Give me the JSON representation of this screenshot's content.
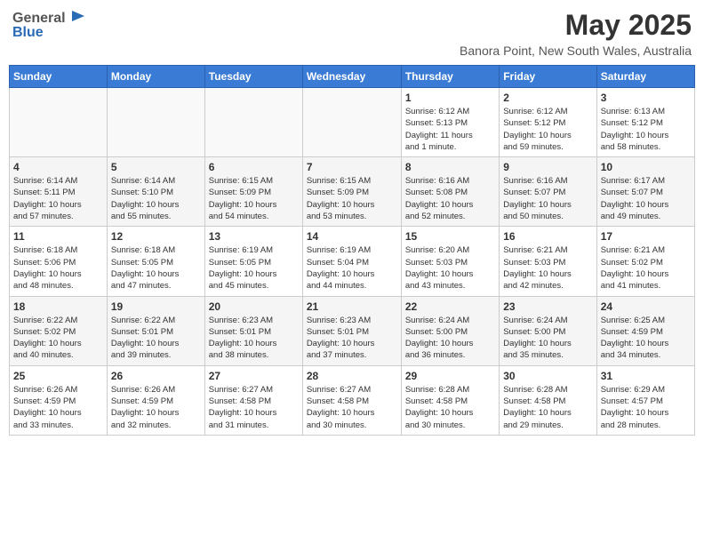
{
  "logo": {
    "general": "General",
    "blue": "Blue"
  },
  "title": {
    "month_year": "May 2025",
    "location": "Banora Point, New South Wales, Australia"
  },
  "weekdays": [
    "Sunday",
    "Monday",
    "Tuesday",
    "Wednesday",
    "Thursday",
    "Friday",
    "Saturday"
  ],
  "weeks": [
    [
      {
        "day": "",
        "info": ""
      },
      {
        "day": "",
        "info": ""
      },
      {
        "day": "",
        "info": ""
      },
      {
        "day": "",
        "info": ""
      },
      {
        "day": "1",
        "info": "Sunrise: 6:12 AM\nSunset: 5:13 PM\nDaylight: 11 hours\nand 1 minute."
      },
      {
        "day": "2",
        "info": "Sunrise: 6:12 AM\nSunset: 5:12 PM\nDaylight: 10 hours\nand 59 minutes."
      },
      {
        "day": "3",
        "info": "Sunrise: 6:13 AM\nSunset: 5:12 PM\nDaylight: 10 hours\nand 58 minutes."
      }
    ],
    [
      {
        "day": "4",
        "info": "Sunrise: 6:14 AM\nSunset: 5:11 PM\nDaylight: 10 hours\nand 57 minutes."
      },
      {
        "day": "5",
        "info": "Sunrise: 6:14 AM\nSunset: 5:10 PM\nDaylight: 10 hours\nand 55 minutes."
      },
      {
        "day": "6",
        "info": "Sunrise: 6:15 AM\nSunset: 5:09 PM\nDaylight: 10 hours\nand 54 minutes."
      },
      {
        "day": "7",
        "info": "Sunrise: 6:15 AM\nSunset: 5:09 PM\nDaylight: 10 hours\nand 53 minutes."
      },
      {
        "day": "8",
        "info": "Sunrise: 6:16 AM\nSunset: 5:08 PM\nDaylight: 10 hours\nand 52 minutes."
      },
      {
        "day": "9",
        "info": "Sunrise: 6:16 AM\nSunset: 5:07 PM\nDaylight: 10 hours\nand 50 minutes."
      },
      {
        "day": "10",
        "info": "Sunrise: 6:17 AM\nSunset: 5:07 PM\nDaylight: 10 hours\nand 49 minutes."
      }
    ],
    [
      {
        "day": "11",
        "info": "Sunrise: 6:18 AM\nSunset: 5:06 PM\nDaylight: 10 hours\nand 48 minutes."
      },
      {
        "day": "12",
        "info": "Sunrise: 6:18 AM\nSunset: 5:05 PM\nDaylight: 10 hours\nand 47 minutes."
      },
      {
        "day": "13",
        "info": "Sunrise: 6:19 AM\nSunset: 5:05 PM\nDaylight: 10 hours\nand 45 minutes."
      },
      {
        "day": "14",
        "info": "Sunrise: 6:19 AM\nSunset: 5:04 PM\nDaylight: 10 hours\nand 44 minutes."
      },
      {
        "day": "15",
        "info": "Sunrise: 6:20 AM\nSunset: 5:03 PM\nDaylight: 10 hours\nand 43 minutes."
      },
      {
        "day": "16",
        "info": "Sunrise: 6:21 AM\nSunset: 5:03 PM\nDaylight: 10 hours\nand 42 minutes."
      },
      {
        "day": "17",
        "info": "Sunrise: 6:21 AM\nSunset: 5:02 PM\nDaylight: 10 hours\nand 41 minutes."
      }
    ],
    [
      {
        "day": "18",
        "info": "Sunrise: 6:22 AM\nSunset: 5:02 PM\nDaylight: 10 hours\nand 40 minutes."
      },
      {
        "day": "19",
        "info": "Sunrise: 6:22 AM\nSunset: 5:01 PM\nDaylight: 10 hours\nand 39 minutes."
      },
      {
        "day": "20",
        "info": "Sunrise: 6:23 AM\nSunset: 5:01 PM\nDaylight: 10 hours\nand 38 minutes."
      },
      {
        "day": "21",
        "info": "Sunrise: 6:23 AM\nSunset: 5:01 PM\nDaylight: 10 hours\nand 37 minutes."
      },
      {
        "day": "22",
        "info": "Sunrise: 6:24 AM\nSunset: 5:00 PM\nDaylight: 10 hours\nand 36 minutes."
      },
      {
        "day": "23",
        "info": "Sunrise: 6:24 AM\nSunset: 5:00 PM\nDaylight: 10 hours\nand 35 minutes."
      },
      {
        "day": "24",
        "info": "Sunrise: 6:25 AM\nSunset: 4:59 PM\nDaylight: 10 hours\nand 34 minutes."
      }
    ],
    [
      {
        "day": "25",
        "info": "Sunrise: 6:26 AM\nSunset: 4:59 PM\nDaylight: 10 hours\nand 33 minutes."
      },
      {
        "day": "26",
        "info": "Sunrise: 6:26 AM\nSunset: 4:59 PM\nDaylight: 10 hours\nand 32 minutes."
      },
      {
        "day": "27",
        "info": "Sunrise: 6:27 AM\nSunset: 4:58 PM\nDaylight: 10 hours\nand 31 minutes."
      },
      {
        "day": "28",
        "info": "Sunrise: 6:27 AM\nSunset: 4:58 PM\nDaylight: 10 hours\nand 30 minutes."
      },
      {
        "day": "29",
        "info": "Sunrise: 6:28 AM\nSunset: 4:58 PM\nDaylight: 10 hours\nand 30 minutes."
      },
      {
        "day": "30",
        "info": "Sunrise: 6:28 AM\nSunset: 4:58 PM\nDaylight: 10 hours\nand 29 minutes."
      },
      {
        "day": "31",
        "info": "Sunrise: 6:29 AM\nSunset: 4:57 PM\nDaylight: 10 hours\nand 28 minutes."
      }
    ]
  ]
}
